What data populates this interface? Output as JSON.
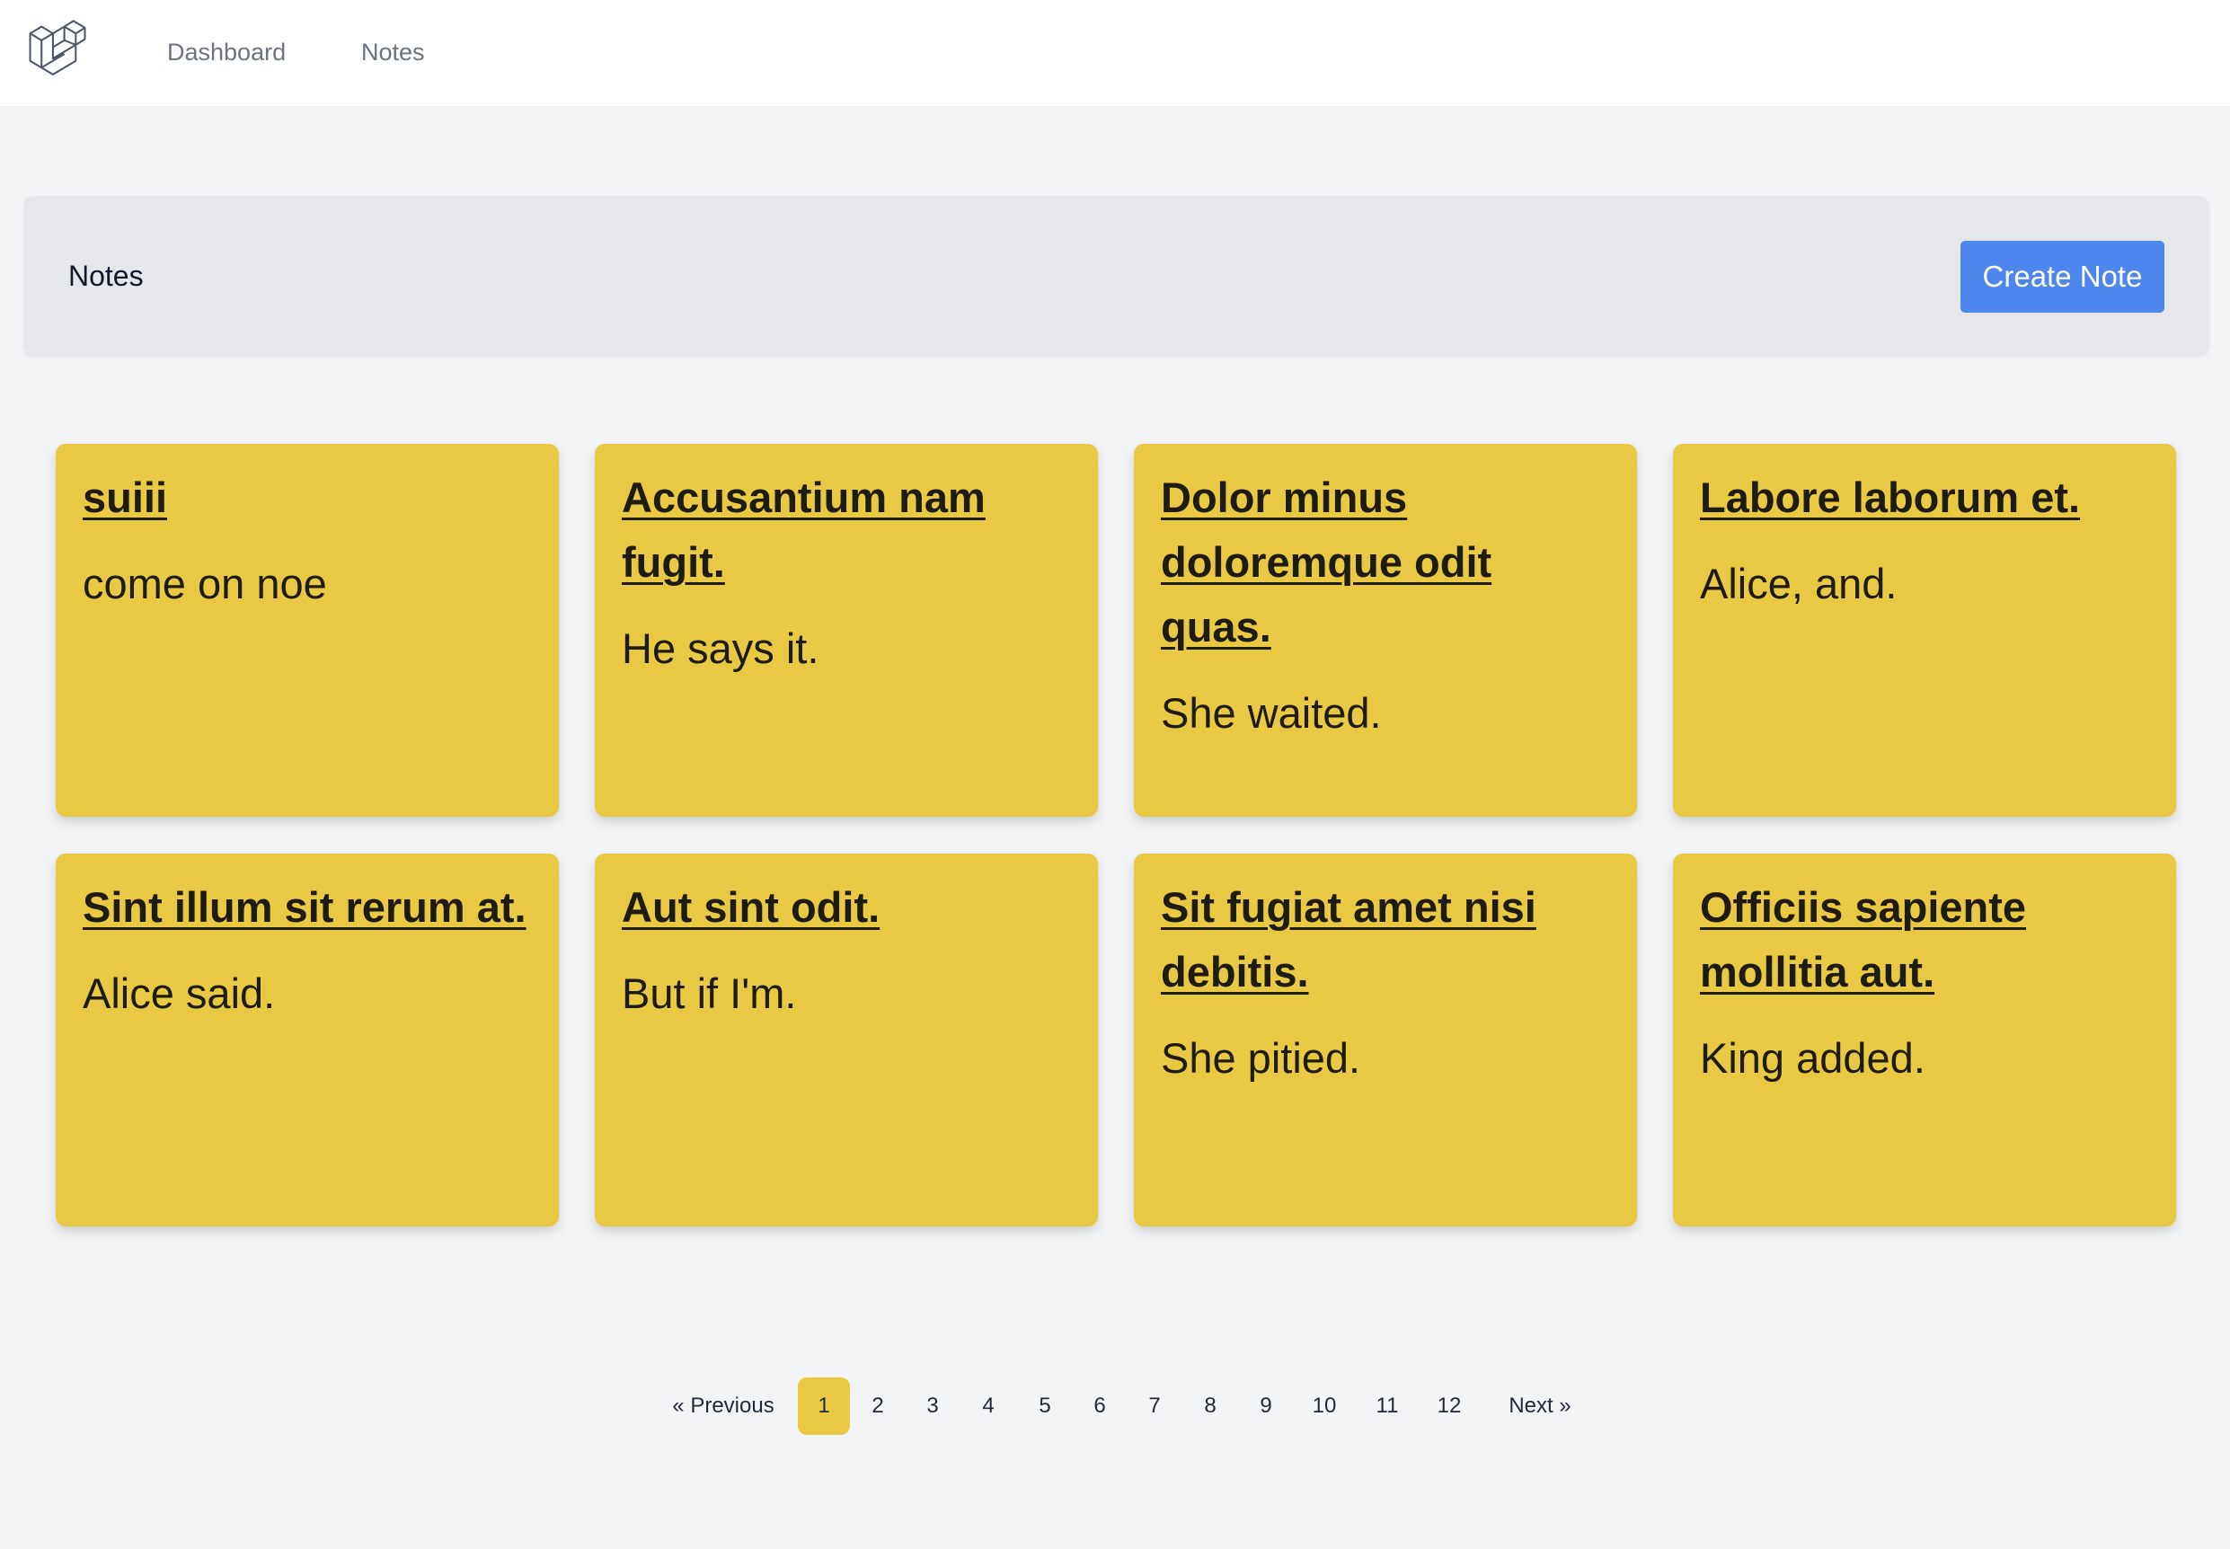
{
  "nav": {
    "links": [
      "Dashboard",
      "Notes"
    ]
  },
  "header": {
    "title": "Notes",
    "create_button": "Create Note"
  },
  "notes": [
    {
      "title": "suiii",
      "body": "come on noe"
    },
    {
      "title": "Accusantium nam fugit.",
      "body": "He says it."
    },
    {
      "title": "Dolor minus doloremque odit quas.",
      "body": "She waited."
    },
    {
      "title": "Labore laborum et.",
      "body": "Alice, and."
    },
    {
      "title": "Sint illum sit rerum at.",
      "body": "Alice said."
    },
    {
      "title": "Aut sint odit.",
      "body": "But if I'm."
    },
    {
      "title": "Sit fugiat amet nisi debitis.",
      "body": "She pitied."
    },
    {
      "title": "Officiis sapiente mollitia aut.",
      "body": "King added."
    }
  ],
  "pagination": {
    "previous": "« Previous",
    "next": "Next »",
    "pages": [
      "1",
      "2",
      "3",
      "4",
      "5",
      "6",
      "7",
      "8",
      "9",
      "10",
      "11",
      "12"
    ],
    "current": "1"
  },
  "colors": {
    "card": "#e9c944",
    "accent": "#4f86ee",
    "background": "#f3f4f6"
  }
}
